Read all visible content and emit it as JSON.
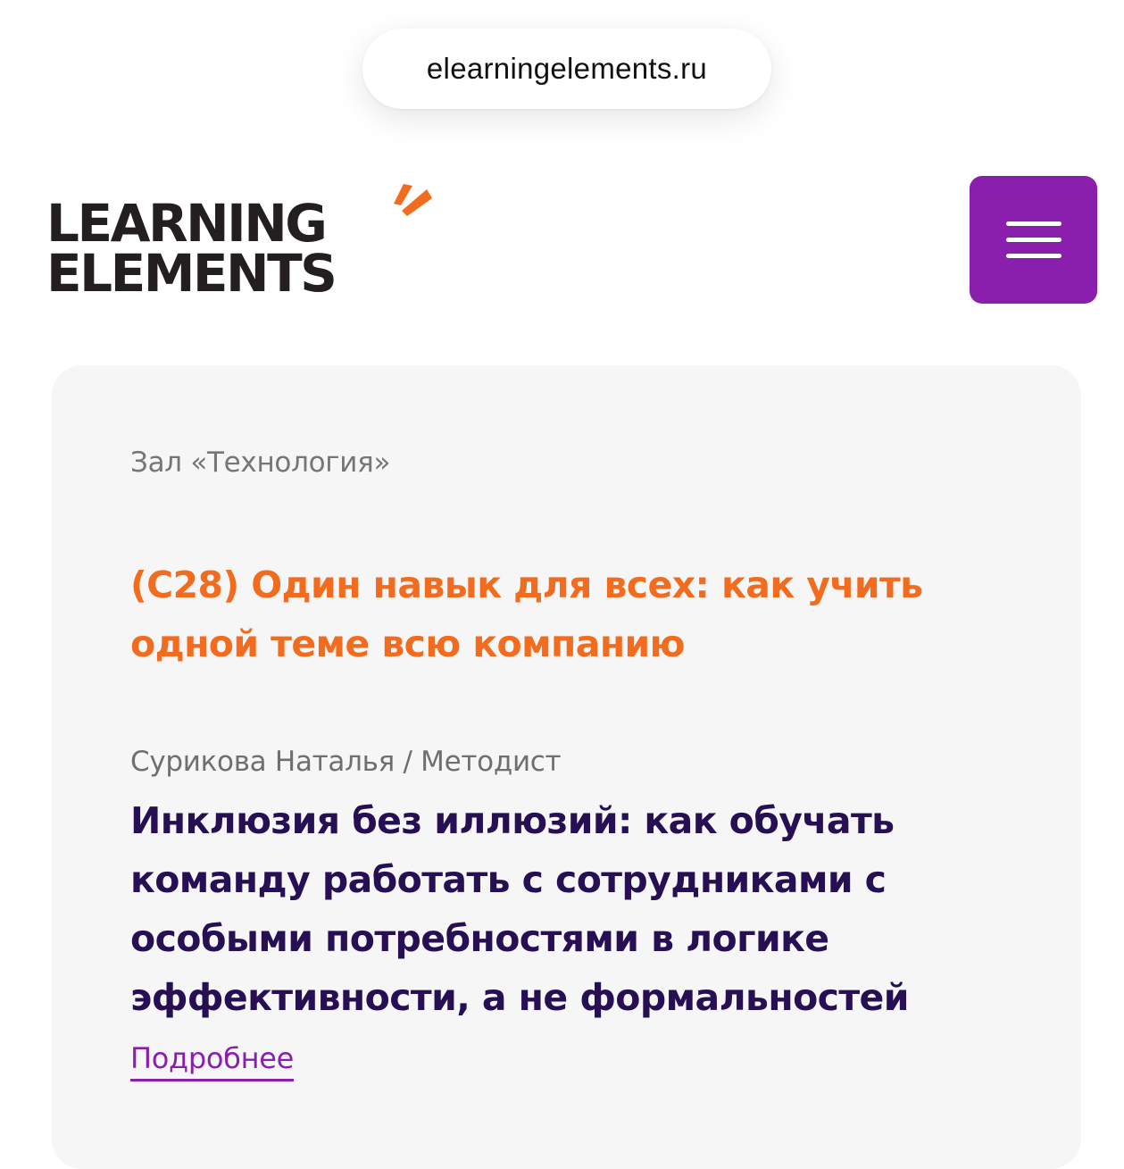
{
  "browser": {
    "url": "elearningelements.ru"
  },
  "header": {
    "logo_line1": "LEARNING",
    "logo_line2": "ELEMENTS",
    "menu_icon": "hamburger-menu-icon"
  },
  "colors": {
    "accent_orange": "#f26c1f",
    "accent_purple": "#8a1fad",
    "title_dark": "#260f52",
    "card_bg": "#f6f6f7"
  },
  "card": {
    "hall": "Зал «Технология»",
    "session_title": "(С28) Один навык для всех: как учить одной теме всю компанию",
    "speaker": "Сурикова Наталья / Методист",
    "talk_title": "Инклюзия без иллюзий: как обучать команду работать с сотрудниками с особыми потребностями в логике эффективности, а не формальностей",
    "more_link": "Подробнее"
  }
}
